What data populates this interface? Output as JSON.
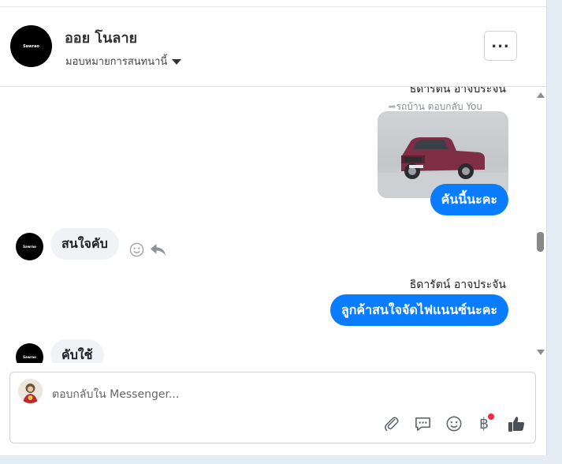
{
  "header": {
    "avatar_text": "Sawrao",
    "contact_name": "ออย โนลาย",
    "assign_label": "มอบหมายการสนทนานี้"
  },
  "thread": {
    "sender_name_top": "ธิดารัตน์ อาจประจัน",
    "reply_note": "รถบ้าน ตอบกลับ You",
    "outgoing_1": "คันนี้นะคะ",
    "incoming_1": "สนใจคับ",
    "sender_name_2": "ธิดารัตน์ อาจประจัน",
    "outgoing_2": "ลูกค้าสนใจจัดไฟแนนซ์นะคะ",
    "incoming_2": "คับใช้",
    "avatar_text": "Sawrao"
  },
  "composer": {
    "placeholder": "ตอบกลับใน Messenger...",
    "value": "",
    "tools": [
      "paperclip-icon",
      "saved-reply-icon",
      "emoji-icon",
      "baht-payment-icon",
      "thumbs-up-icon"
    ]
  },
  "colors": {
    "accent": "#0a7cff",
    "incoming_bubble": "#f0f2f5",
    "notification_dot": "#f02849"
  }
}
